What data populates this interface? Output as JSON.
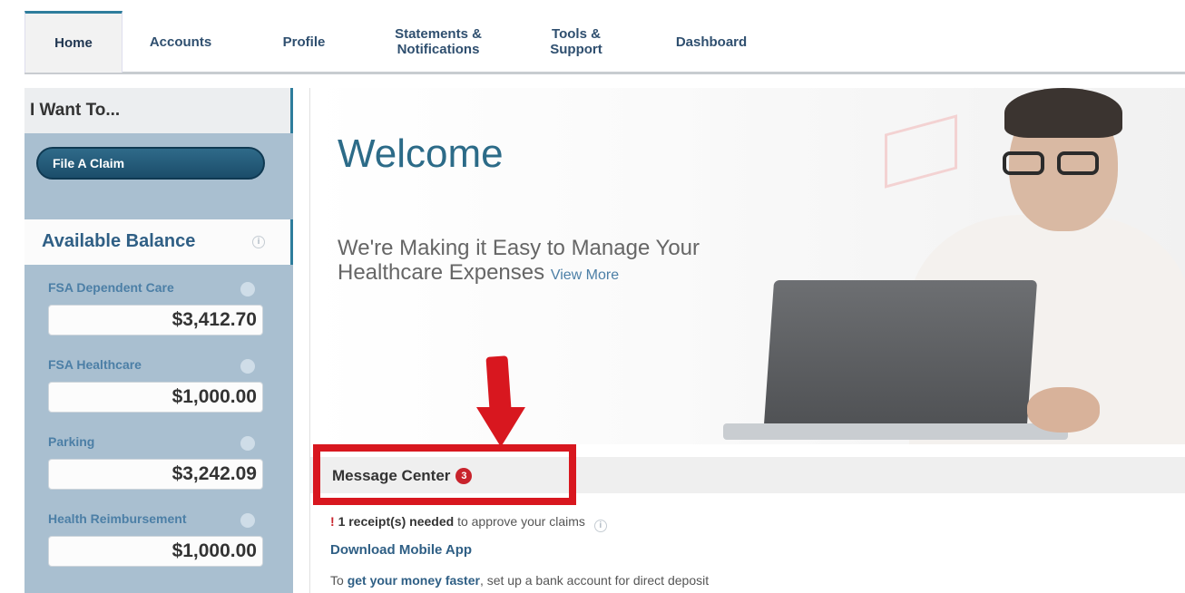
{
  "nav": {
    "tabs": [
      {
        "label": "Home",
        "active": true
      },
      {
        "label": "Accounts"
      },
      {
        "label": "Profile"
      },
      {
        "label_line1": "Statements &",
        "label_line2": "Notifications"
      },
      {
        "label_line1": "Tools &",
        "label_line2": "Support"
      },
      {
        "label": "Dashboard"
      }
    ]
  },
  "sidebar": {
    "i_want_title": "I Want To...",
    "file_claim_label": "File A Claim",
    "balance_title": "Available Balance",
    "info_icon_glyph": "i",
    "accounts": [
      {
        "name": "FSA Dependent Care",
        "amount": "$3,412.70"
      },
      {
        "name": "FSA Healthcare",
        "amount": "$1,000.00"
      },
      {
        "name": "Parking",
        "amount": "$3,242.09"
      },
      {
        "name": "Health Reimbursement",
        "amount": "$1,000.00"
      }
    ]
  },
  "hero": {
    "welcome": "Welcome",
    "tagline": "We're Making it Easy to Manage Your Healthcare Expenses",
    "view_more": "View More"
  },
  "message_center": {
    "title": "Message Center",
    "badge_count": "3",
    "receipt_prefix": "!",
    "receipt_link": "1 receipt(s) needed",
    "receipt_suffix": "to approve your claims",
    "download_app": "Download Mobile App",
    "deposit_prefix": "To",
    "deposit_link": "get your money faster",
    "deposit_suffix": ", set up a bank account for direct deposit"
  },
  "colors": {
    "accent": "#2e7d9c",
    "sidebar_bg": "#a9bfd0",
    "annotation_red": "#d8171f",
    "badge_red": "#c8232c"
  }
}
